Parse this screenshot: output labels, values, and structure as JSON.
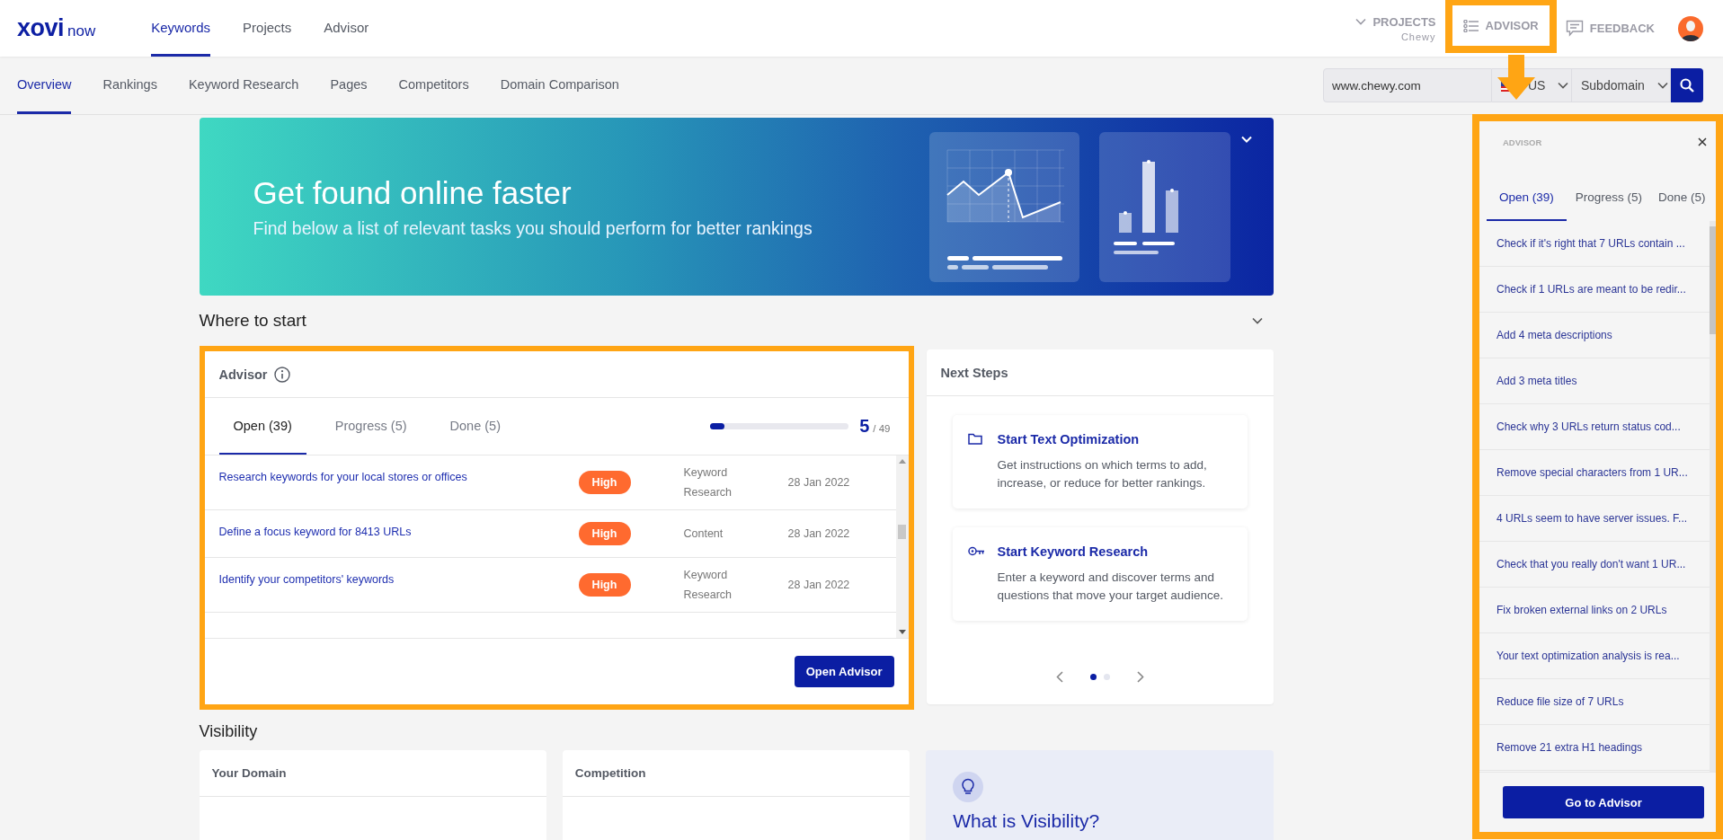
{
  "header": {
    "logo": {
      "wordmark": "xovi",
      "subtitle": "now"
    },
    "nav": [
      {
        "label": "Keywords",
        "selected": true
      },
      {
        "label": "Projects",
        "selected": false
      },
      {
        "label": "Advisor",
        "selected": false
      }
    ],
    "projects": {
      "label": "PROJECTS",
      "project": "Chewy"
    },
    "advisor_button": {
      "label": "ADVISOR"
    },
    "feedback_button": {
      "label": "FEEDBACK"
    }
  },
  "subnav": {
    "items": [
      {
        "label": "Overview",
        "selected": true
      },
      {
        "label": "Rankings",
        "selected": false
      },
      {
        "label": "Keyword Research",
        "selected": false
      },
      {
        "label": "Pages",
        "selected": false
      },
      {
        "label": "Competitors",
        "selected": false
      },
      {
        "label": "Domain Comparison",
        "selected": false
      }
    ],
    "domain_field": {
      "value": "www.chewy.com"
    },
    "country": "US",
    "scope": "Subdomain"
  },
  "banner": {
    "title": "Get found online faster",
    "subtitle": "Find below a list of relevant tasks you should perform for better rankings"
  },
  "where_to_start": {
    "title": "Where to start"
  },
  "advisor_card": {
    "title": "Advisor",
    "tabs": [
      {
        "label": "Open (39)",
        "selected": true
      },
      {
        "label": "Progress (5)",
        "selected": false
      },
      {
        "label": "Done (5)",
        "selected": false
      }
    ],
    "progress": {
      "level": 0.1,
      "count": "5",
      "total": "/ 49"
    },
    "rows": [
      {
        "task": "Research keywords for your local stores or offices",
        "priority": "High",
        "category": "Keyword Research",
        "date": "28 Jan 2022"
      },
      {
        "task": "Define a focus keyword for 8413 URLs",
        "priority": "High",
        "category": "Content",
        "date": "28 Jan 2022"
      },
      {
        "task": "Identify your competitors' keywords",
        "priority": "High",
        "category": "Keyword Research",
        "date": "28 Jan 2022"
      }
    ],
    "button": "Open Advisor"
  },
  "next_steps": {
    "title": "Next Steps",
    "steps": [
      {
        "kind": "folder",
        "title": "Start Text Optimization",
        "description": "Get instructions on which terms to add, increase, or reduce for better rankings."
      },
      {
        "kind": "key",
        "title": "Start Keyword Research",
        "description": "Enter a keyword and discover terms and questions that move your target audience."
      }
    ],
    "dots": [
      {
        "selected": true
      },
      {
        "selected": false
      }
    ]
  },
  "visibility": {
    "title": "Visibility",
    "cards": [
      {
        "title": "Your Domain"
      },
      {
        "title": "Competition"
      }
    ],
    "info": {
      "title": "What is Visibility?"
    }
  },
  "advisor_panel": {
    "title": "ADVISOR",
    "tabs": [
      {
        "label": "Open (39)",
        "selected": true
      },
      {
        "label": "Progress (5)",
        "selected": false
      },
      {
        "label": "Done (5)",
        "selected": false
      }
    ],
    "items": [
      "Check if it's right that 7 URLs contain ...",
      "Check if 1 URLs are meant to be redir...",
      "Add 4 meta descriptions",
      "Add 3 meta titles",
      "Check why 3 URLs return status cod...",
      "Remove special characters from 1 UR...",
      "4 URLs seem to have server issues. F...",
      "Check that you really don't want 1 UR...",
      "Fix broken external links on 2 URLs",
      "Your text optimization analysis is rea...",
      "Reduce file size of 7 URLs",
      "Remove 21 extra H1 headings"
    ],
    "button": "Go to Advisor"
  }
}
